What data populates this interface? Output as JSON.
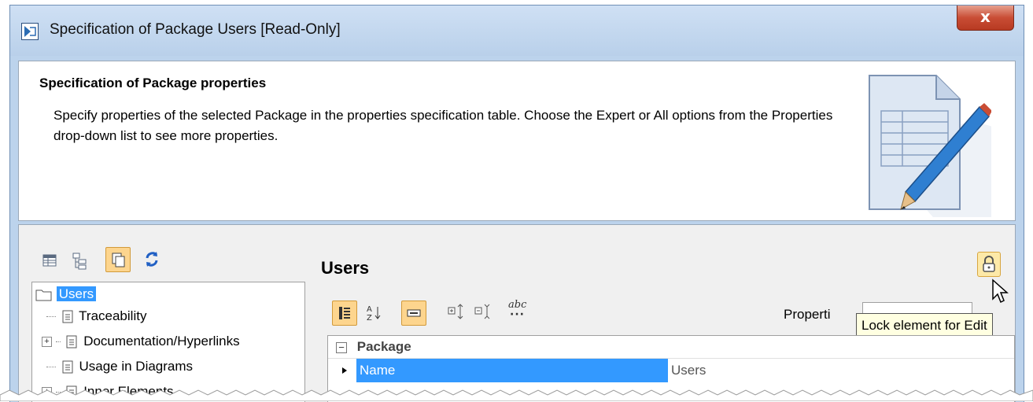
{
  "window": {
    "title": "Specification of Package Users [Read-Only]",
    "close_label": "x"
  },
  "header": {
    "heading": "Specification of Package properties",
    "description": "Specify properties of the selected Package in the properties specification table. Choose the Expert or All options from the Properties drop-down list to see more properties."
  },
  "left_toolbar": {
    "icons": [
      "table-view-icon",
      "tree-view-icon",
      "copy-icon",
      "refresh-icon"
    ]
  },
  "tree": {
    "items": [
      {
        "label": "Users",
        "selected": true,
        "icon": "folder-icon"
      },
      {
        "label": "Traceability",
        "icon": "document-icon"
      },
      {
        "label": "Documentation/Hyperlinks",
        "icon": "document-icon",
        "expandable": true
      },
      {
        "label": "Usage in Diagrams",
        "icon": "document-icon"
      },
      {
        "label": "Inner Elements",
        "icon": "document-icon",
        "expandable": true
      }
    ]
  },
  "right": {
    "title": "Users",
    "properties_label": "Properti",
    "tooltip": "Lock element for Edit"
  },
  "props_toolbar": {
    "icons": [
      "categorized-icon",
      "sort-alpha-icon",
      "description-icon",
      "expand-all-icon",
      "collapse-all-icon",
      "abc-more-icon"
    ],
    "abc_text": "abc"
  },
  "grid": {
    "group": "Package",
    "rows": [
      {
        "name": "Name",
        "value": "Users"
      }
    ]
  },
  "colors": {
    "selection": "#3399ff",
    "active_button": "#fdd58e",
    "close_button": "#c94d35",
    "window_frame": "#bcd3ec"
  }
}
